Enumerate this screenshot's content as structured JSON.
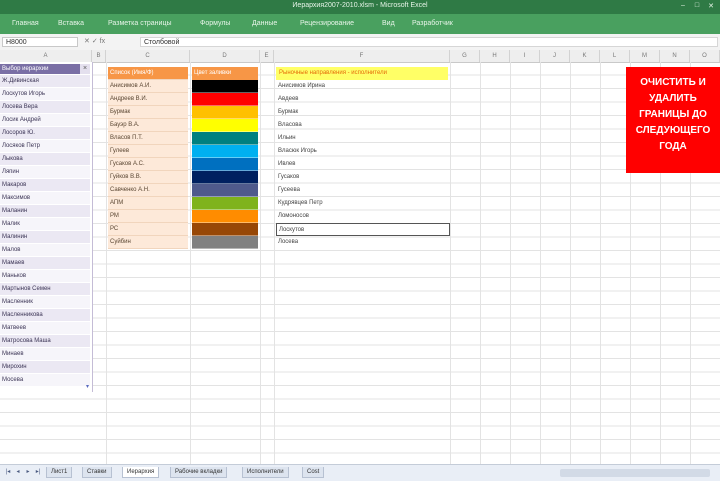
{
  "window": {
    "title": "Иерархия2007-2010.xlsm - Microsoft Excel",
    "min": "–",
    "max": "□",
    "close": "✕"
  },
  "ribbon": {
    "tabs": [
      "Главная",
      "Вставка",
      "Разметка страницы",
      "Формулы",
      "Данные",
      "Рецензирование",
      "Вид",
      "Разработчик"
    ]
  },
  "formula_bar": {
    "name_box": "Н8000",
    "fx_label": "fx",
    "content": "Столбовой"
  },
  "columns": [
    "A",
    "B",
    "C",
    "D",
    "E",
    "F",
    "G",
    "H",
    "I",
    "J",
    "K",
    "L",
    "M",
    "N",
    "O"
  ],
  "panel": {
    "header": "Выбор иерархии",
    "close": "×",
    "items": [
      "Ж.Дивинская",
      "Лоскутов Игорь",
      "Лосева Вера",
      "Лосик Андрей",
      "Лосоров Ю.",
      "Лосяков Петр",
      "Лыкова",
      "Ляпин",
      "Макаров",
      "Максимов",
      "Маланин",
      "Малик",
      "Малинин",
      "Малов",
      "Мамаев",
      "Маньков",
      "Мартынов Семен",
      "Масленник",
      "Масленникова",
      "Матвеев",
      "Матросова Маша",
      "Минаев",
      "Мирохин",
      "Мосева"
    ],
    "scroll_icon": "down-arrow-icon"
  },
  "tableC": {
    "header": "Список (Имя/Ф)",
    "rows": [
      "Анисимов А.И.",
      "Андреев В.И.",
      "Бурмак",
      "Бауэр В.А.",
      "Власов П.Т.",
      "Гулеев",
      "Гусаков А.С.",
      "Гуйков В.В.",
      "Савченко А.Н.",
      "АПМ",
      "РМ",
      "РС",
      "Суйбин"
    ]
  },
  "tableD": {
    "header": "Цвет заливки",
    "swatches": [
      "#000000",
      "#ff0000",
      "#ffc000",
      "#ffff00",
      "#008080",
      "#00b0f0",
      "#0070c0",
      "#002060",
      "#4f5a8c",
      "#7fb31c",
      "#ff8c00",
      "#974706",
      "#808080"
    ]
  },
  "tableE": {
    "header": "Рыночные направления - исполнители",
    "rows": [
      "Анисимов Ирина",
      "Авдеев",
      "Бурмак",
      "Власова",
      "Ильин",
      "Власюк Игорь",
      "Ивлев",
      "Гусаков",
      "Гусеева",
      "Кудрявцев Петр",
      "Ломоносов",
      "Лоскутов",
      "Лосева"
    ],
    "selected_row_index": 11
  },
  "note": "Очистить и удалить границы до следующего года",
  "sheets": {
    "tabs": [
      "Лист1",
      "Ставки",
      "Иерархия",
      "Рабочие вкладки",
      "Исполнители",
      "Cost"
    ],
    "active_index": 2
  },
  "colors": {
    "titlebar": "#2f7a45",
    "ribbon": "#49a05f",
    "panel_header": "#7a6fa5",
    "orange_header": "#f79646",
    "note_background": "#ff0000"
  }
}
